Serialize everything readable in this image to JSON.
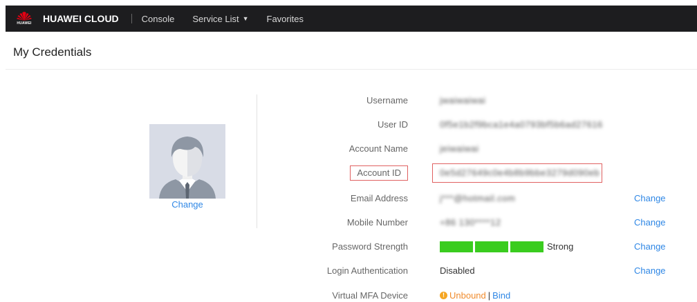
{
  "topbar": {
    "logo_text": "HUAWEI",
    "brand": "HUAWEI CLOUD",
    "nav": {
      "console": "Console",
      "service_list": "Service List",
      "favorites": "Favorites"
    }
  },
  "page": {
    "title": "My Credentials"
  },
  "avatar": {
    "change_label": "Change"
  },
  "credentials": {
    "username": {
      "label": "Username",
      "value": "jwaiwaiwai"
    },
    "user_id": {
      "label": "User ID",
      "value": "0f5e1b2f9bca1e4a0793bf5b6ad27616"
    },
    "account_name": {
      "label": "Account Name",
      "value": "jeiwaiwai"
    },
    "account_id": {
      "label": "Account ID",
      "value": "0e5d27649c0e4b8b9bbe3279d090eb"
    },
    "email": {
      "label": "Email Address",
      "value": "j***@hotmail.com",
      "action": "Change"
    },
    "mobile": {
      "label": "Mobile Number",
      "value": "+86 130****12",
      "action": "Change"
    },
    "password": {
      "label": "Password Strength",
      "strength_text": "Strong",
      "strength_level": 3,
      "strength_max": 3,
      "action": "Change"
    },
    "login_auth": {
      "label": "Login Authentication",
      "value": "Disabled",
      "action": "Change"
    },
    "mfa": {
      "label": "Virtual MFA Device",
      "status": "Unbound",
      "separator": "|",
      "bind": "Bind"
    }
  },
  "colors": {
    "topbar_bg": "#1d1d1f",
    "link": "#2f87e5",
    "highlight_border": "#e06060",
    "strength_bar": "#3acc1f",
    "warning": "#f5a623"
  }
}
